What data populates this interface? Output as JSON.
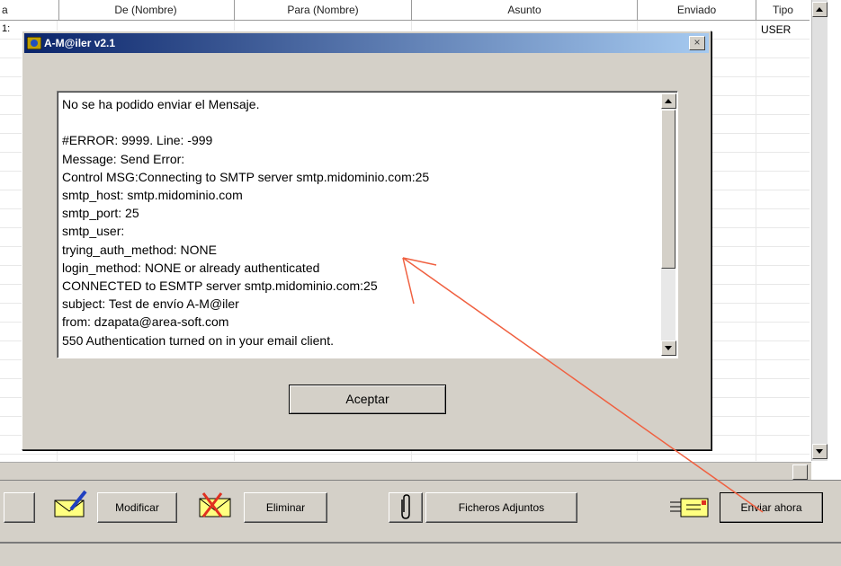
{
  "grid": {
    "columns": [
      "a",
      "De (Nombre)",
      "Para (Nombre)",
      "Asunto",
      "Enviado",
      "Tipo"
    ],
    "row1_first": "1:",
    "row1_tipo": "USER"
  },
  "dialog": {
    "title": "A-M@iler v2.1",
    "close_glyph": "×",
    "message_lines": [
      "No se ha podido enviar el Mensaje.",
      "",
      "#ERROR: 9999. Line: -999",
      "Message: Send Error:",
      "Control MSG:Connecting to SMTP server smtp.midominio.com:25",
      "smtp_host: smtp.midominio.com",
      "smtp_port: 25",
      "smtp_user:",
      "trying_auth_method: NONE",
      "login_method: NONE or already authenticated",
      "CONNECTED to ESMTP server smtp.midominio.com:25",
      "subject: Test de envío A-M@iler",
      "from: dzapata@area-soft.com",
      "550 Authentication turned on in your email client."
    ],
    "ok_label": "Aceptar"
  },
  "toolbar": {
    "modify_label": "Modificar",
    "delete_label": "Eliminar",
    "attachments_label": "Ficheros Adjuntos",
    "send_now_label": "Enviar ahora"
  },
  "icons": {
    "dialog_app": "app-icon",
    "modify": "envelope-pencil-icon",
    "delete": "envelope-x-icon",
    "attachments": "paperclip-icon",
    "send": "envelope-send-icon"
  },
  "colors": {
    "annotation_arrow": "#f06040",
    "title_bar_start": "#0a246a",
    "title_bar_end": "#a6caf0"
  }
}
